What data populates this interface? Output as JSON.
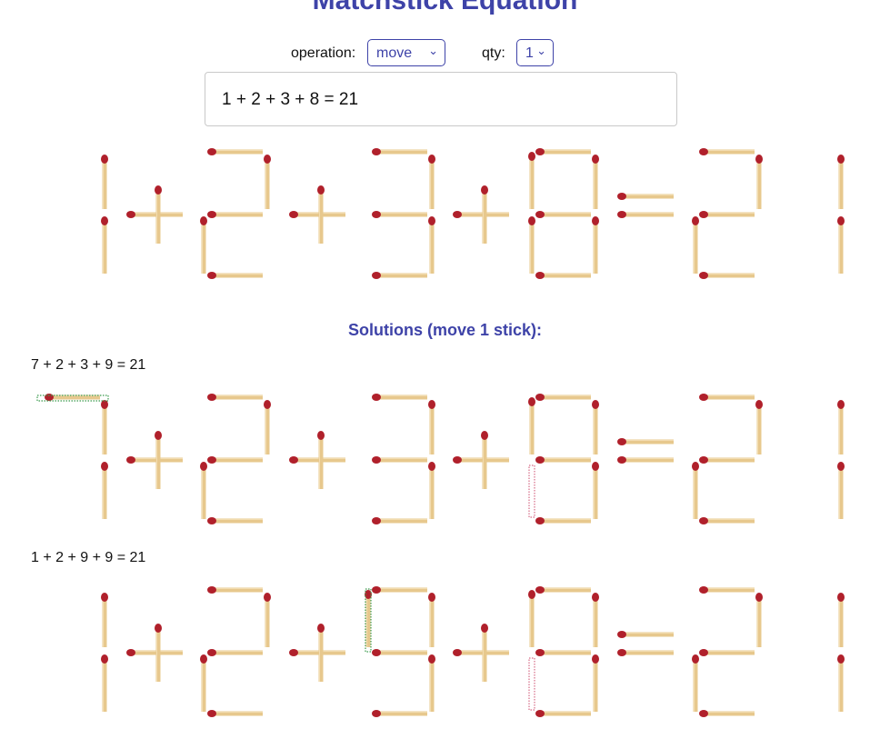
{
  "title": "Matchstick Equation",
  "controls": {
    "operation_label": "operation:",
    "operation_value": "move",
    "qty_label": "qty:",
    "qty_value": "1"
  },
  "equation_input": "1 + 2 + 3 + 8 = 21",
  "solutions_heading": "Solutions (move 1 stick):",
  "solutions": [
    {
      "label": "7 + 2 + 3 + 9 = 21"
    },
    {
      "label": "1 + 2 + 9 + 9 = 21"
    }
  ],
  "colors": {
    "accent": "#3e43a8",
    "match_body": "#e7c88d",
    "match_head": "#b0202b",
    "added_outline": "#3a9a4c",
    "removed_outline": "#d66a86"
  }
}
